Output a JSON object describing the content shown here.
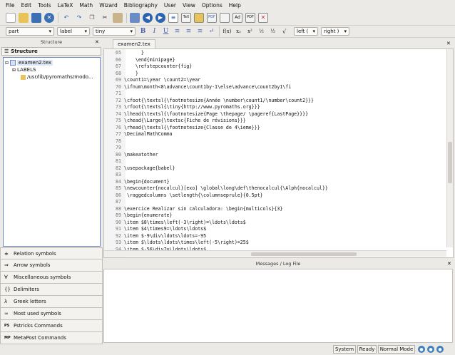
{
  "menubar": [
    "File",
    "Edit",
    "Tools",
    "LaTeX",
    "Math",
    "Wizard",
    "Bibliography",
    "User",
    "View",
    "Options",
    "Help"
  ],
  "toolbar2": {
    "combo_part": "part",
    "combo_label": "label",
    "combo_size": "tiny",
    "left_delim": "left (",
    "right_delim": "right )"
  },
  "structure_panel": {
    "title": "Structure",
    "tab": "Structure",
    "tree": {
      "root": "examen2.tex",
      "labels": "LABELS",
      "path": "/usr/lib/pyromaths/modo..."
    }
  },
  "side_items": [
    {
      "icon": "±",
      "label": "Relation symbols"
    },
    {
      "icon": "⇒",
      "label": "Arrow symbols"
    },
    {
      "icon": "∀",
      "label": "Miscellaneous symbols"
    },
    {
      "icon": "{}",
      "label": "Delimiters"
    },
    {
      "icon": "λ",
      "label": "Greek letters"
    },
    {
      "icon": "∞",
      "label": "Most used symbols"
    },
    {
      "icon": "PS",
      "label": "Pstricks Commands"
    },
    {
      "icon": "MP",
      "label": "MetaPost Commands"
    }
  ],
  "editor": {
    "tab": "examen2.tex",
    "lines": [
      {
        "n": "65",
        "t": "      }"
      },
      {
        "n": "66",
        "t": "    \\end{minipage}"
      },
      {
        "n": "67",
        "t": "    \\refstepcounter{fig}"
      },
      {
        "n": "68",
        "t": "    }"
      },
      {
        "n": "69",
        "t": "\\count1=\\year \\count2=\\year"
      },
      {
        "n": "70",
        "t": "\\ifnum\\month<8\\advance\\count1by-1\\else\\advance\\count2by1\\fi"
      },
      {
        "n": "71",
        "t": ""
      },
      {
        "n": "72",
        "t": "\\cfoot{\\textsl{\\footnotesize{Année \\number\\count1/\\number\\count2}}}"
      },
      {
        "n": "73",
        "t": "\\rfoot{\\textsl{\\tiny{http://www.pyromaths.org}}}"
      },
      {
        "n": "74",
        "t": "\\lhead{\\textsl{\\footnotesize{Page \\thepage/ \\pageref{LastPage}}}}"
      },
      {
        "n": "75",
        "t": "\\chead{\\Large{\\textsc{Fiche de révisions}}}"
      },
      {
        "n": "76",
        "t": "\\rhead{\\textsl{\\footnotesize{Classe de 4\\ieme}}}"
      },
      {
        "n": "77",
        "t": "\\DecimalMathComma"
      },
      {
        "n": "78",
        "t": ""
      },
      {
        "n": "79",
        "t": ""
      },
      {
        "n": "80",
        "t": "\\makeatother"
      },
      {
        "n": "81",
        "t": ""
      },
      {
        "n": "82",
        "t": "\\usepackage{babel}"
      },
      {
        "n": "83",
        "t": ""
      },
      {
        "n": "84",
        "t": "\\begin{document}"
      },
      {
        "n": "85",
        "t": "\\newcounter{nocalcul}[exo] \\global\\long\\def\\thenocalcul{\\Alph{nocalcul}}"
      },
      {
        "n": "86",
        "t": " \\raggedcolumns \\setlength{\\columnseprule}{0.5pt}"
      },
      {
        "n": "87",
        "t": ""
      },
      {
        "n": "88",
        "t": "\\exercice Realizar sin calculadora: \\begin{multicols}{3}"
      },
      {
        "n": "89",
        "t": "\\begin{enumerate}"
      },
      {
        "n": "90",
        "t": "\\item $8\\times\\left(-3\\right)=\\ldots\\ldots$"
      },
      {
        "n": "91",
        "t": "\\item $4\\times9=\\ldots\\ldots$"
      },
      {
        "n": "92",
        "t": "\\item $-9\\div\\ldots\\ldots=-95"
      },
      {
        "n": "93",
        "t": "\\item $\\ldots\\ldots\\times\\left(-5\\right)=25$"
      },
      {
        "n": "94",
        "t": "\\item $-56\\div7=\\ldots\\ldots$"
      }
    ]
  },
  "messages_panel": {
    "title": "Messages / Log File"
  },
  "status": {
    "system": "System",
    "ready": "Ready",
    "mode": "Normal Mode"
  },
  "colors": {
    "accent": "#4a62ae",
    "selection": "#6b86c8",
    "command": "#111111"
  }
}
